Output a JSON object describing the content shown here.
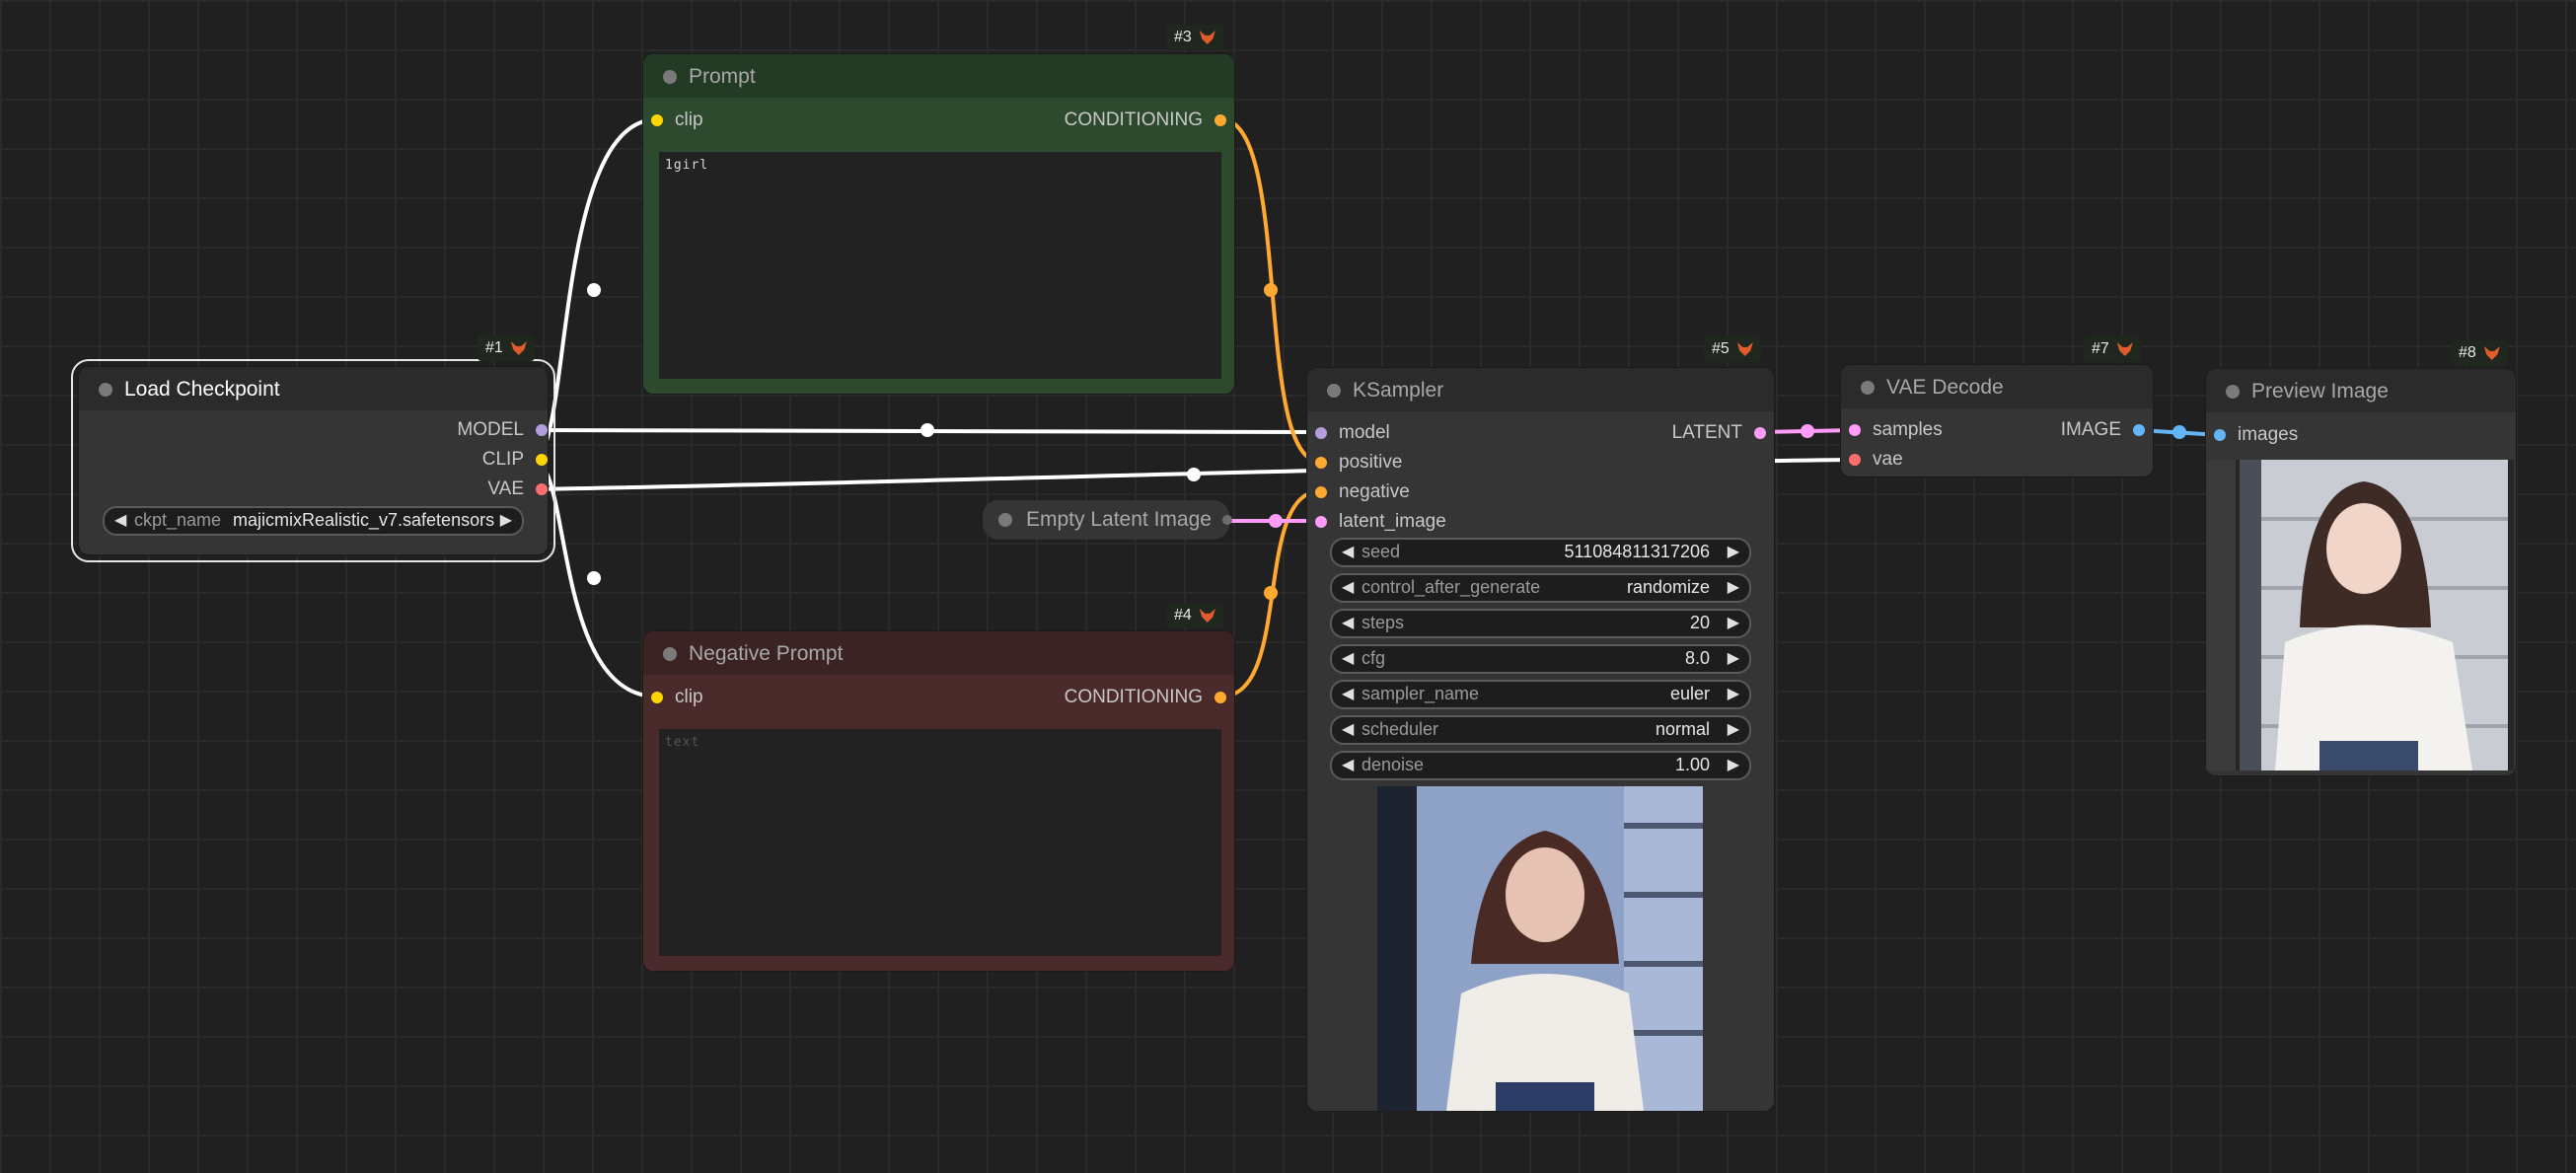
{
  "colors": {
    "background": "#202020",
    "node": "#353535",
    "prompt_node": "#2d4a2e",
    "negative_node": "#4a2a2a",
    "model": "#b39ddb",
    "clip": "#ffd500",
    "vae": "#ff6e6e",
    "conditioning": "#ffa931",
    "latent": "#ff9cf9",
    "image": "#64b5f6"
  },
  "nodes": {
    "checkpoint": {
      "badge": "#1",
      "title": "Load Checkpoint",
      "outputs": {
        "model": "MODEL",
        "clip": "CLIP",
        "vae": "VAE"
      },
      "ckpt_name_label": "ckpt_name",
      "ckpt_name_value": "majicmixRealistic_v7.safetensors"
    },
    "prompt": {
      "badge": "#3",
      "title": "Prompt",
      "input": "clip",
      "output": "CONDITIONING",
      "text": "1girl"
    },
    "negative": {
      "badge": "#4",
      "title": "Negative Prompt",
      "input": "clip",
      "output": "CONDITIONING",
      "placeholder": "text"
    },
    "empty_latent": {
      "title": "Empty Latent Image"
    },
    "ksampler": {
      "badge": "#5",
      "title": "KSampler",
      "inputs": {
        "model": "model",
        "positive": "positive",
        "negative": "negative",
        "latent": "latent_image"
      },
      "output": "LATENT",
      "widgets": [
        {
          "name": "seed",
          "value": "511084811317206"
        },
        {
          "name": "control_after_generate",
          "value": "randomize"
        },
        {
          "name": "steps",
          "value": "20"
        },
        {
          "name": "cfg",
          "value": "8.0"
        },
        {
          "name": "sampler_name",
          "value": "euler"
        },
        {
          "name": "scheduler",
          "value": "normal"
        },
        {
          "name": "denoise",
          "value": "1.00"
        }
      ]
    },
    "vae_decode": {
      "badge": "#7",
      "title": "VAE Decode",
      "inputs": {
        "samples": "samples",
        "vae": "vae"
      },
      "output": "IMAGE"
    },
    "preview": {
      "badge": "#8",
      "title": "Preview Image",
      "input": "images"
    }
  }
}
